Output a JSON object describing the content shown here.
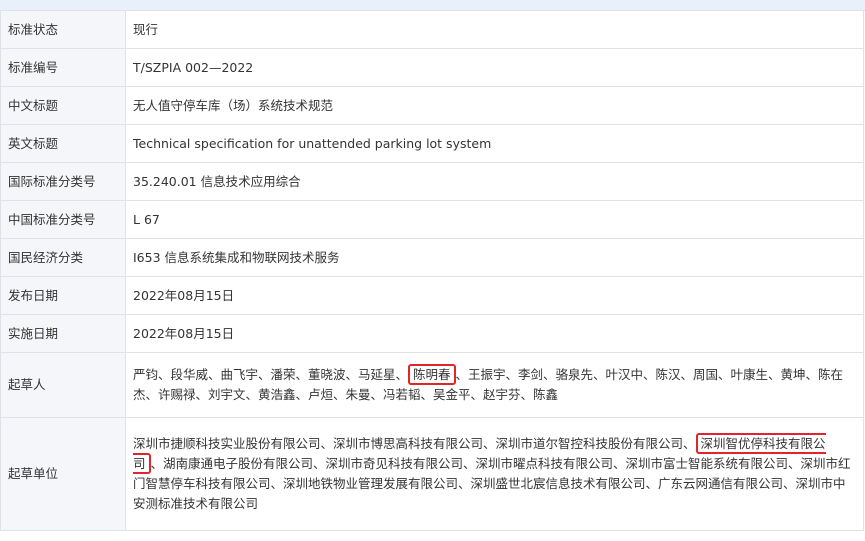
{
  "rows": [
    {
      "label": "标准状态",
      "value": "现行"
    },
    {
      "label": "标准编号",
      "value": "T/SZPIA 002—2022"
    },
    {
      "label": "中文标题",
      "value": "无人值守停车库（场）系统技术规范"
    },
    {
      "label": "英文标题",
      "value": "Technical specification for unattended parking lot system"
    },
    {
      "label": "国际标准分类号",
      "value": "35.240.01 信息技术应用综合"
    },
    {
      "label": "中国标准分类号",
      "value": "L 67"
    },
    {
      "label": "国民经济分类",
      "value": "I653 信息系统集成和物联网技术服务"
    },
    {
      "label": "发布日期",
      "value": "2022年08月15日"
    },
    {
      "label": "实施日期",
      "value": "2022年08月15日"
    }
  ],
  "drafters": {
    "label": "起草人",
    "before": "严钧、段华威、曲飞宇、潘荣、董晓波、马延星、",
    "highlight": "陈明春",
    "after": "、王振宇、李剑、骆泉先、叶汉中、陈汉、周国、叶康生、黄坤、陈在杰、许赐禄、刘宇文、黄浩鑫、卢烜、朱曼、冯若韬、吴金平、赵宇芬、陈鑫"
  },
  "units": {
    "label": "起草单位",
    "before": "深圳市捷顺科技实业股份有限公司、深圳市博思高科技有限公司、深圳市道尔智控科技股份有限公司、",
    "highlight": "深圳智优停科技有限公司",
    "after": "、湖南康通电子股份有限公司、深圳市奇见科技有限公司、深圳市曜点科技有限公司、深圳市富士智能系统有限公司、深圳市红门智慧停车科技有限公司、深圳地铁物业管理发展有限公司、深圳盛世北宸信息技术有限公司、广东云网通信有限公司、深圳市中安测标准技术有限公司"
  },
  "colors": {
    "label_bg": "#f4f6f9",
    "border": "#dfe3e8",
    "highlight": "#e0262b",
    "top_strip": "#e8f1fb"
  }
}
